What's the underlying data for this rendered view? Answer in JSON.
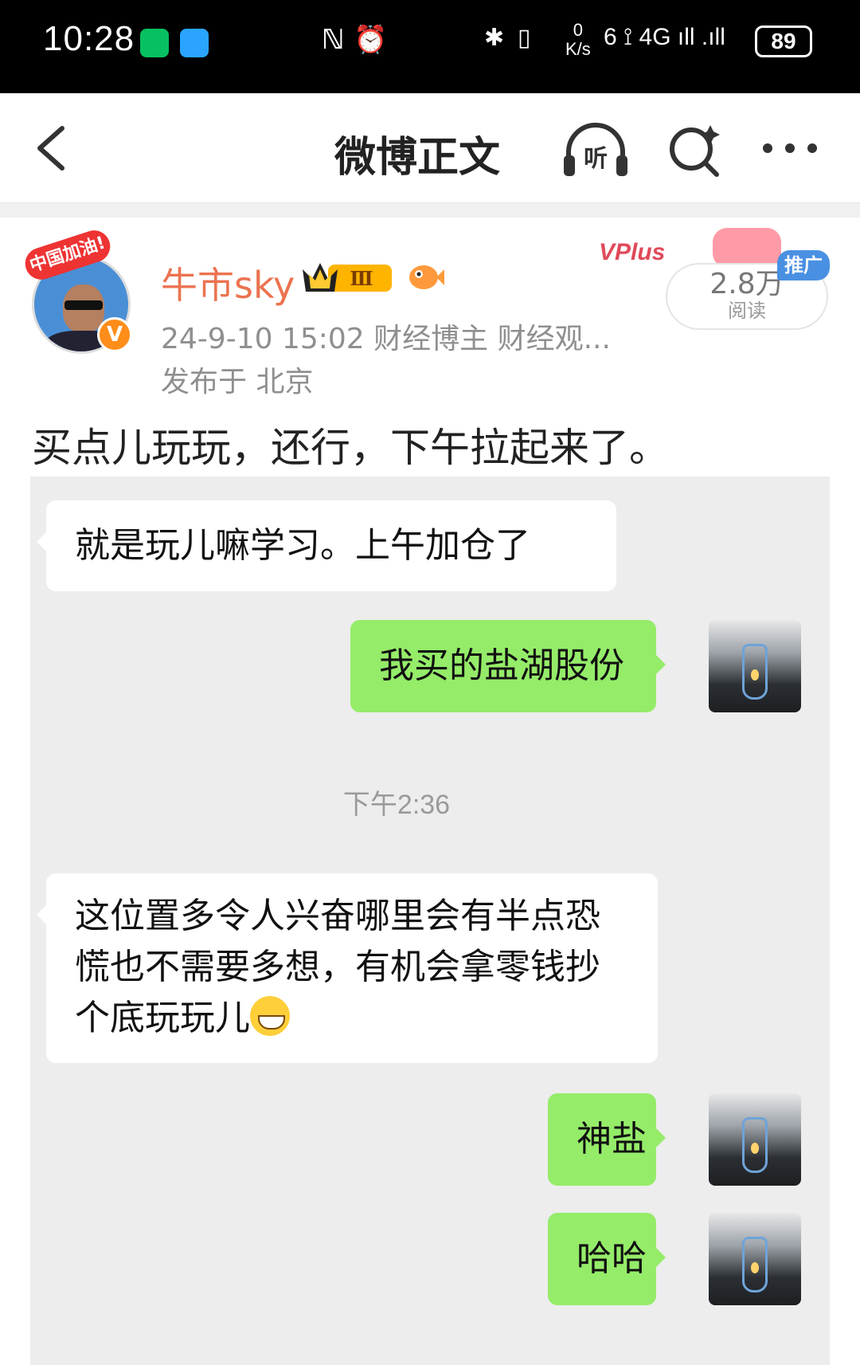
{
  "status_bar": {
    "time": "10:28",
    "center_icons": "ℕ ⏰",
    "net_speed_top": "0",
    "net_speed_unit": "K/s",
    "signal": "6 ⟟ 4G ıll  .ıll",
    "battery": "89"
  },
  "nav": {
    "title": "微博正文",
    "listen_label": "听"
  },
  "post": {
    "username": "牛市sky",
    "level_badge": "Ⅲ",
    "avatar_badge": "中国加油!",
    "verified_badge": "V",
    "meta": "24-9-10 15:02   财经博主 财经观...",
    "location": "发布于 北京",
    "promo_brand": "VPlus",
    "reads": "2.8万",
    "reads_label": "阅读",
    "promo_tag": "推广",
    "text": "买点儿玩玩，还行，下午拉起来了。"
  },
  "chat": {
    "messages": [
      {
        "side": "left",
        "text": "就是玩儿嘛学习。上午加仓了"
      },
      {
        "side": "right",
        "text": "我买的盐湖股份"
      },
      {
        "side": "left",
        "text": "这位置多令人兴奋哪里会有半点恐慌也不需要多想，有机会拿零钱抄个底玩玩儿"
      },
      {
        "side": "right",
        "text": "神盐"
      },
      {
        "side": "right",
        "text": "哈哈"
      }
    ],
    "timestamp": "下午2:36"
  },
  "colors": {
    "username": "#eb7350",
    "bubble_right": "#95ec69",
    "chat_bg": "#ededed",
    "promo_blue": "#4a90e2"
  }
}
